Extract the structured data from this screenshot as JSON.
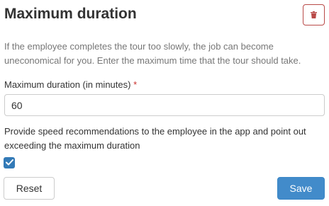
{
  "header": {
    "title": "Maximum duration",
    "delete_icon": "trash-icon"
  },
  "description": "If the employee completes the tour too slowly, the job can become uneconomical for you. Enter the maximum time that the tour should take.",
  "duration_field": {
    "label": "Maximum duration (in minutes)",
    "required_marker": "*",
    "value": "60"
  },
  "speed_recommendations": {
    "label": "Provide speed recommendations to the employee in the app and point out exceeding the maximum duration",
    "checked": true,
    "check_icon": "checkmark-icon"
  },
  "actions": {
    "reset_label": "Reset",
    "save_label": "Save"
  },
  "colors": {
    "danger": "#b94a48",
    "primary": "#428bca",
    "required": "#c9302c"
  }
}
